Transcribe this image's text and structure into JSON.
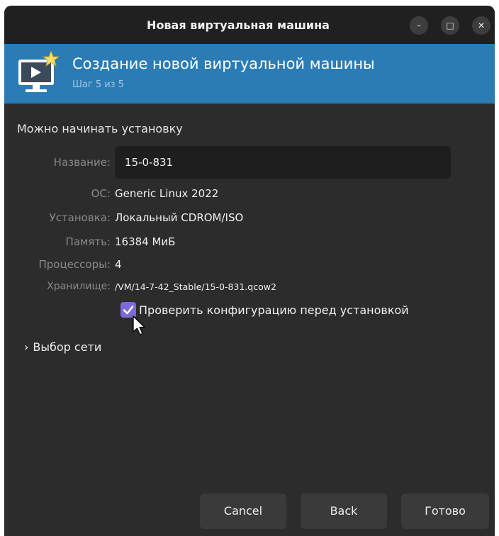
{
  "window": {
    "title": "Новая виртуальная машина",
    "controls": {
      "minimize": "–",
      "maximize": "□",
      "close": "✕"
    }
  },
  "header": {
    "title": "Создание новой виртуальной машины",
    "subtitle": "Шаг 5 из 5",
    "icon": "monitor-new-vm-icon"
  },
  "summary": {
    "ready_text": "Можно начинать установку",
    "name": {
      "label": "Название:",
      "value": "15-0-831"
    },
    "os": {
      "label": "ОС:",
      "value": "Generic Linux 2022"
    },
    "install": {
      "label": "Установка:",
      "value": "Локальный CDROM/ISO"
    },
    "memory": {
      "label": "Память:",
      "value": "16384 МиБ"
    },
    "cpus": {
      "label": "Процессоры:",
      "value": "4"
    },
    "storage": {
      "label": "Хранилище:",
      "value": "/VM/14-7-42_Stable/15-0-831.qcow2"
    }
  },
  "customize": {
    "label": "Проверить конфигурацию перед установкой",
    "checked": true
  },
  "network": {
    "label": "Выбор сети",
    "chevron": "›"
  },
  "buttons": {
    "cancel": "Cancel",
    "back": "Back",
    "finish": "Готово"
  },
  "colors": {
    "header_bg": "#2b7cb5",
    "checkbox_accent": "#7d6ad7",
    "window_bg": "#2c2c2c"
  }
}
